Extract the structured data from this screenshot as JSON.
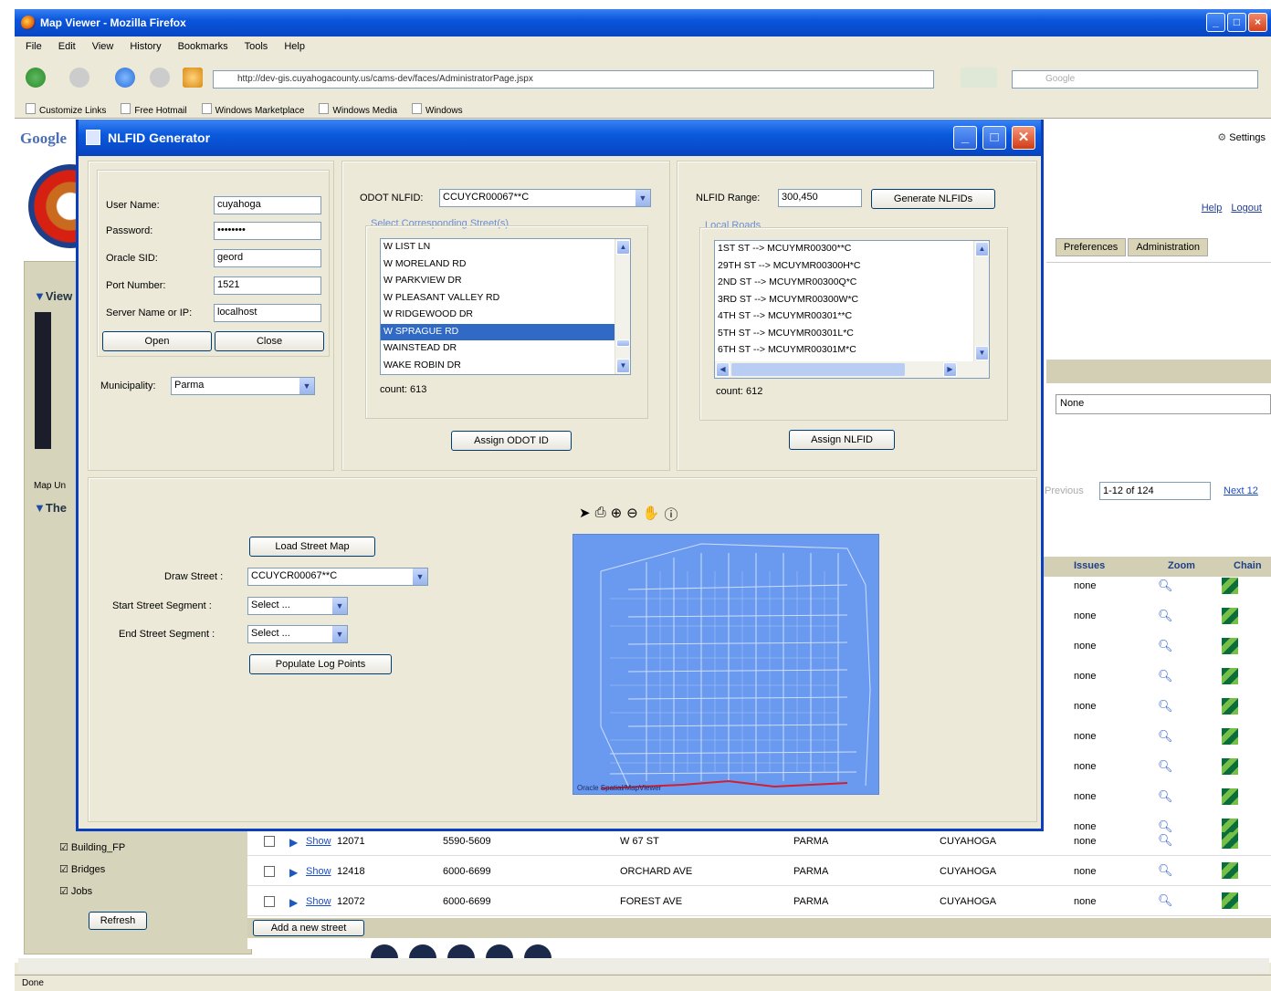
{
  "browser": {
    "title": "Map Viewer - Mozilla Firefox",
    "menu": [
      "File",
      "Edit",
      "View",
      "History",
      "Bookmarks",
      "Tools",
      "Help"
    ],
    "url": "http://dev-gis.cuyahogacounty.us/cams-dev/faces/AdministratorPage.jspx",
    "search_placeholder": "Google",
    "links": [
      "Customize Links",
      "Free Hotmail",
      "Windows Marketplace",
      "Windows Media",
      "Windows"
    ],
    "status": "Done"
  },
  "page": {
    "google_label": "Google",
    "settings_label": "Settings",
    "help_label": "Help",
    "logout_label": "Logout",
    "tabs": [
      "Preferences",
      "Administration"
    ],
    "left": {
      "view_label": "View",
      "map_units_label": "Map Un",
      "themes_label": "The",
      "layers": [
        "Building_FP",
        "Bridges",
        "Jobs"
      ],
      "refresh_label": "Refresh"
    },
    "none_select": "None",
    "pager": {
      "previous": "Previous",
      "range": "1-12 of 124",
      "next": "Next 12"
    },
    "grid_headers": {
      "issues": "Issues",
      "zoom": "Zoom",
      "chain": "Chain"
    },
    "issue_values": [
      "none",
      "none",
      "none",
      "none",
      "none",
      "none",
      "none",
      "none",
      "none"
    ],
    "rows": [
      {
        "show": "Show",
        "id": "12071",
        "range": "5590-5609",
        "street": "W 67 ST",
        "city": "PARMA",
        "county": "CUYAHOGA",
        "issues": "none"
      },
      {
        "show": "Show",
        "id": "12418",
        "range": "6000-6699",
        "street": "ORCHARD AVE",
        "city": "PARMA",
        "county": "CUYAHOGA",
        "issues": "none"
      },
      {
        "show": "Show",
        "id": "12072",
        "range": "6000-6699",
        "street": "FOREST AVE",
        "city": "PARMA",
        "county": "CUYAHOGA",
        "issues": "none"
      }
    ],
    "add_street_label": "Add a new street"
  },
  "dialog": {
    "title": "NLFID Generator",
    "login": {
      "user_label": "User Name:",
      "user_value": "cuyahoga",
      "password_label": "Password:",
      "password_value": "••••••••",
      "sid_label": "Oracle SID:",
      "sid_value": "geord",
      "port_label": "Port Number:",
      "port_value": "1521",
      "server_label": "Server Name or IP:",
      "server_value": "localhost",
      "open_label": "Open",
      "close_label": "Close"
    },
    "municipality_label": "Municipality:",
    "municipality_value": "Parma",
    "odot": {
      "label": "ODOT NLFID:",
      "value": "CCUYCR00067**C",
      "group_label": "Select Corresponding Street(s)",
      "streets": [
        "W LIST LN",
        "W MORELAND RD",
        "W PARKVIEW DR",
        "W PLEASANT VALLEY RD",
        "W RIDGEWOOD DR",
        "W SPRAGUE RD",
        "WAINSTEAD DR",
        "WAKE ROBIN DR"
      ],
      "selected_index": 5,
      "count_text": "count: 613",
      "assign_label": "Assign ODOT ID"
    },
    "nlfid": {
      "range_label": "NLFID Range:",
      "range_value": "300,450",
      "generate_label": "Generate NLFIDs",
      "group_label": "Local Roads",
      "roads": [
        "1ST ST --> MCUYMR00300**C",
        "29TH ST --> MCUYMR00300H*C",
        "2ND ST --> MCUYMR00300Q*C",
        "3RD ST --> MCUYMR00300W*C",
        "4TH ST --> MCUYMR00301**C",
        "5TH ST --> MCUYMR00301L*C",
        "6TH ST --> MCUYMR00301M*C"
      ],
      "count_text": "count: 612",
      "assign_label": "Assign NLFID"
    },
    "map_panel": {
      "load_label": "Load Street Map",
      "draw_label": "Draw Street :",
      "draw_value": "CCUYCR00067**C",
      "start_label": "Start Street Segment :",
      "start_value": "Select ...",
      "end_label": "End Street Segment :",
      "end_value": "Select ...",
      "populate_label": "Populate Log Points",
      "tools": [
        "pointer-icon",
        "print-icon",
        "zoom-in-icon",
        "zoom-out-icon",
        "pan-icon",
        "info-icon"
      ],
      "map_bg": "#6a9aef",
      "map_credit": "Oracle Spatial/MapViewer"
    }
  }
}
